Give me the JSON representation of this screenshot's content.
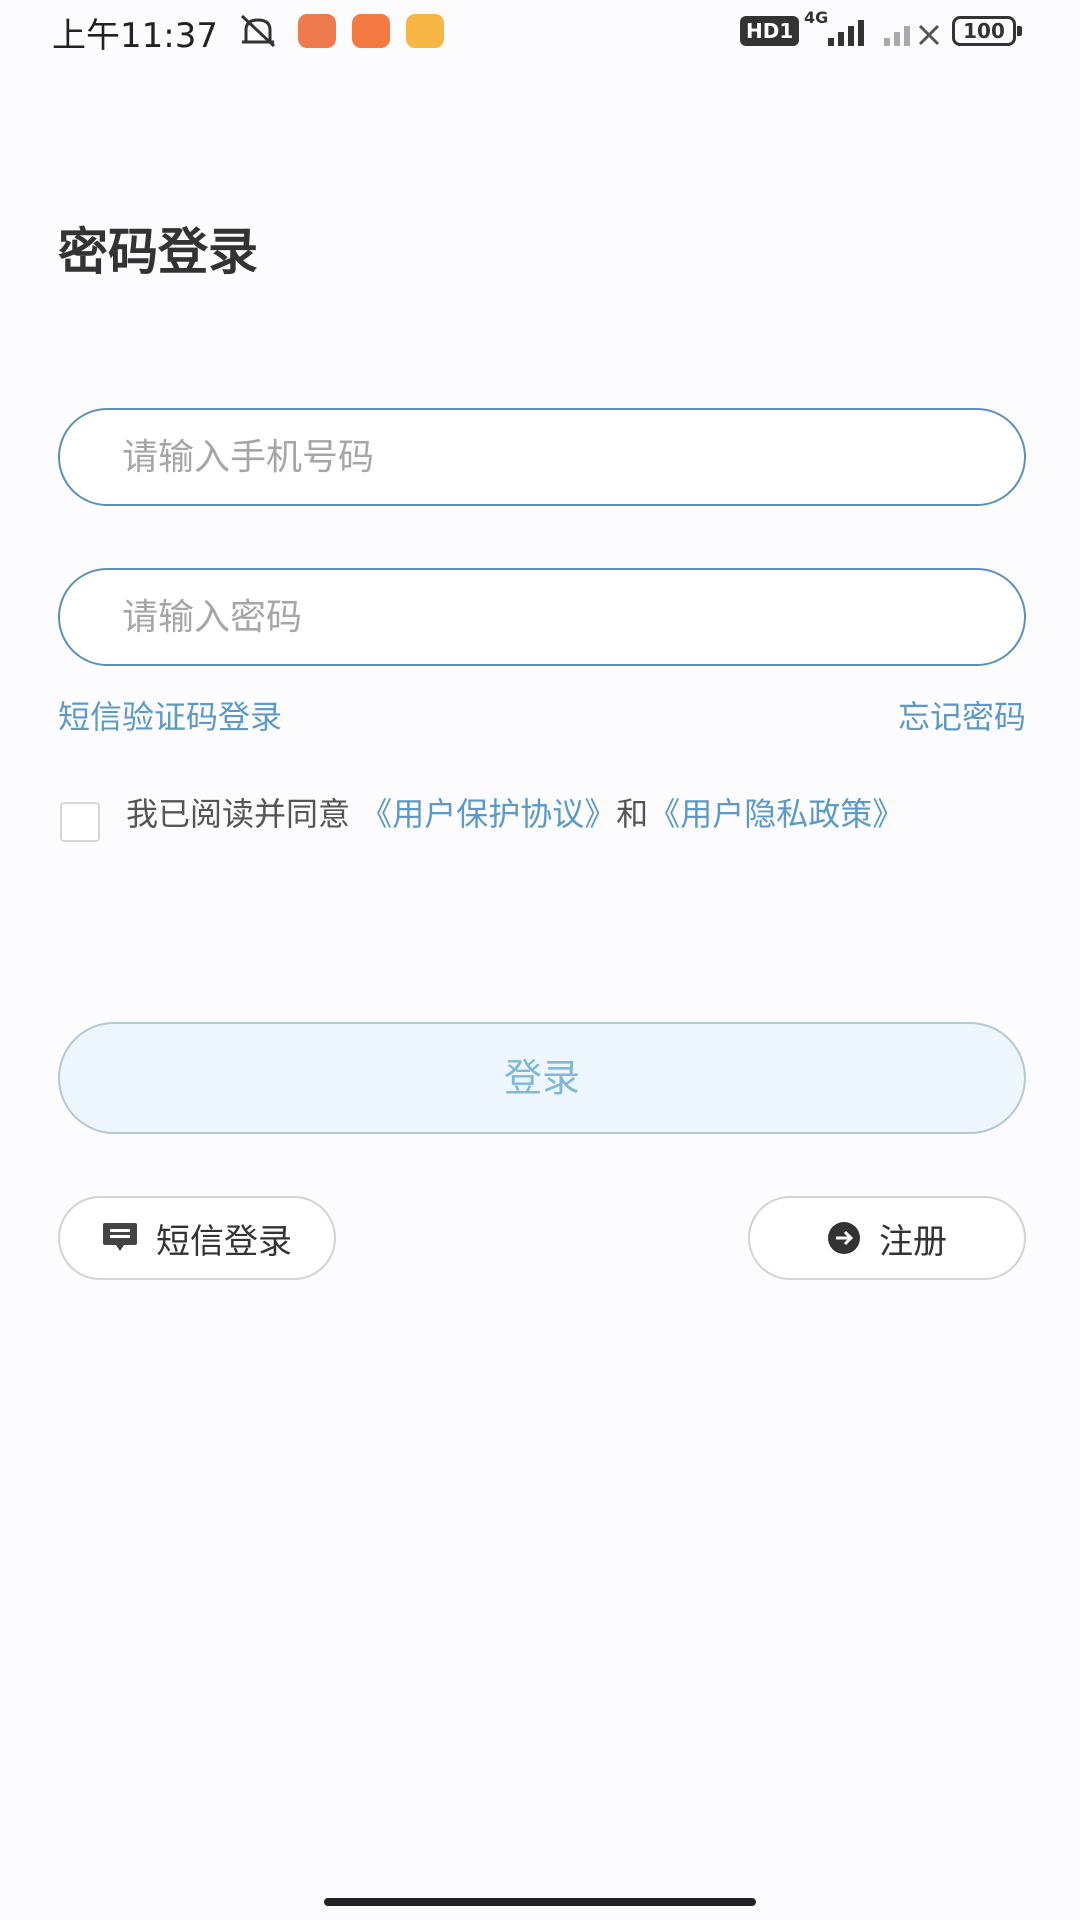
{
  "status_bar": {
    "time": "上午11:37",
    "hd_label": "HD1",
    "network_label": "4G",
    "battery": "100",
    "icons": [
      "mute-icon",
      "app-notification-icon",
      "shopping-app-icon",
      "message-app-icon",
      "signal-icon",
      "no-signal-icon",
      "battery-icon"
    ]
  },
  "page": {
    "title": "密码登录"
  },
  "form": {
    "phone_placeholder": "请输入手机号码",
    "password_placeholder": "请输入密码",
    "sms_code_login_link": "短信验证码登录",
    "forgot_password_link": "忘记密码"
  },
  "agreement": {
    "checked": false,
    "prefix": "我已阅读并同意",
    "user_protocol": "《用户保护协议》",
    "connector": "和",
    "privacy_policy": "《用户隐私政策》"
  },
  "actions": {
    "login_label": "登录",
    "sms_login_label": "短信登录",
    "register_label": "注册"
  },
  "colors": {
    "accent_blue": "#5b9ac8",
    "input_border": "#5b8fbd",
    "login_bg": "#edf6fd",
    "login_text": "#82b8d6"
  }
}
